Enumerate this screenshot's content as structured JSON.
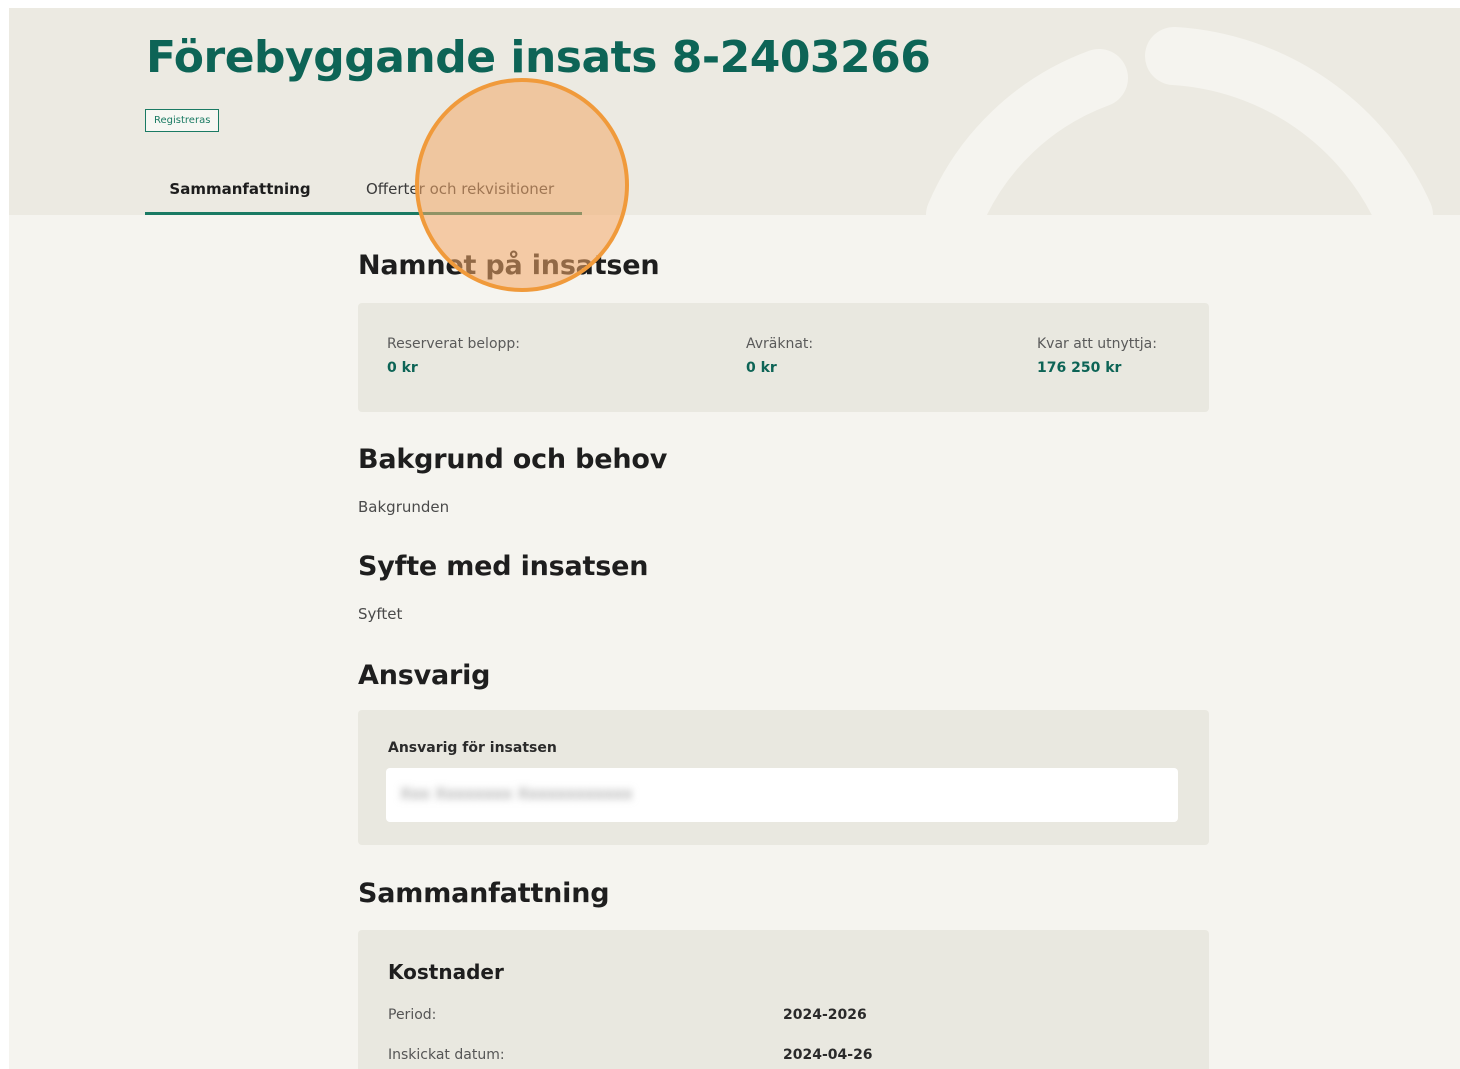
{
  "header": {
    "title": "Förebyggande insats 8-2403266",
    "status_badge": "Registreras"
  },
  "tabs": [
    {
      "label": "Sammanfattning",
      "active": true
    },
    {
      "label": "Offerter och rekvisitioner",
      "active": false
    }
  ],
  "sections": {
    "name": {
      "heading": "Namnet på insatsen",
      "stats": [
        {
          "label": "Reserverat belopp:",
          "value": "0 kr"
        },
        {
          "label": "Avräknat:",
          "value": "0 kr"
        },
        {
          "label": "Kvar att utnyttja:",
          "value": "176 250 kr"
        }
      ]
    },
    "background": {
      "heading": "Bakgrund och behov",
      "text": "Bakgrunden"
    },
    "purpose": {
      "heading": "Syfte med insatsen",
      "text": "Syftet"
    },
    "responsible": {
      "heading": "Ansvarig",
      "field_label": "Ansvarig för insatsen",
      "field_value": "Xxx Xxxxxxxx Xxxxxxxxxxxx"
    },
    "summary": {
      "heading": "Sammanfattning",
      "card_heading": "Kostnader",
      "rows": [
        {
          "label": "Period:",
          "value": "2024-2026"
        },
        {
          "label": "Inskickat datum:",
          "value": "2024-04-26"
        }
      ]
    }
  },
  "colors": {
    "brand_green": "#0d6456",
    "accent_green": "#1a7a63",
    "page_bg": "#f5f4ef",
    "hero_bg": "#eceae2",
    "card_bg": "#e9e8e0",
    "cursor_highlight": "#f09a3b"
  }
}
